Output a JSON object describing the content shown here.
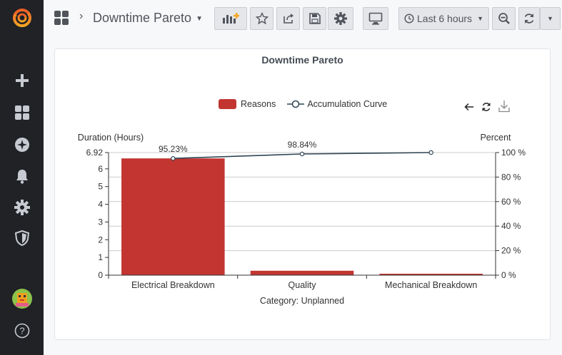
{
  "sidebar": {
    "items": [
      {
        "icon": "grafana-logo-icon"
      },
      {
        "icon": "plus-icon"
      },
      {
        "icon": "dashboards-icon"
      },
      {
        "icon": "compass-icon"
      },
      {
        "icon": "bell-icon"
      },
      {
        "icon": "gear-icon"
      },
      {
        "icon": "shield-icon"
      },
      {
        "icon": "avatar"
      },
      {
        "icon": "help-icon"
      }
    ]
  },
  "topbar": {
    "dashboard_title": "Downtime Pareto",
    "time_range_label": "Last 6 hours"
  },
  "panel": {
    "title": "Downtime Pareto"
  },
  "colors": {
    "bar": "#c23531",
    "line": "#2f4554",
    "sidebar_bg": "#202226"
  },
  "chart_data": {
    "type": "bar",
    "categories": [
      "Electrical Breakdown",
      "Quality",
      "Mechanical Breakdown"
    ],
    "xlabel": "Category: Unplanned",
    "legend": [
      "Reasons",
      "Accumulation Curve"
    ],
    "legend_position": "top-center",
    "series": [
      {
        "name": "Reasons",
        "type": "bar",
        "axis": "left",
        "values": [
          6.59,
          0.25,
          0.08
        ]
      },
      {
        "name": "Accumulation Curve",
        "type": "line",
        "axis": "right",
        "values": [
          95.23,
          98.84,
          100
        ],
        "labels": [
          "95.23%",
          "98.84%",
          ""
        ]
      }
    ],
    "y_left": {
      "label": "Duration (Hours)",
      "ylim": [
        0,
        6.92
      ],
      "ticks": [
        "0",
        "1",
        "2",
        "3",
        "4",
        "5",
        "6",
        "6.92"
      ],
      "tick_values": [
        0,
        1,
        2,
        3,
        4,
        5,
        6,
        6.92
      ]
    },
    "y_right": {
      "label": "Percent",
      "ylim": [
        0,
        100
      ],
      "ticks": [
        "0 %",
        "20 %",
        "40 %",
        "60 %",
        "80 %",
        "100 %"
      ],
      "tick_values": [
        0,
        20,
        40,
        60,
        80,
        100
      ]
    },
    "grid": true
  }
}
